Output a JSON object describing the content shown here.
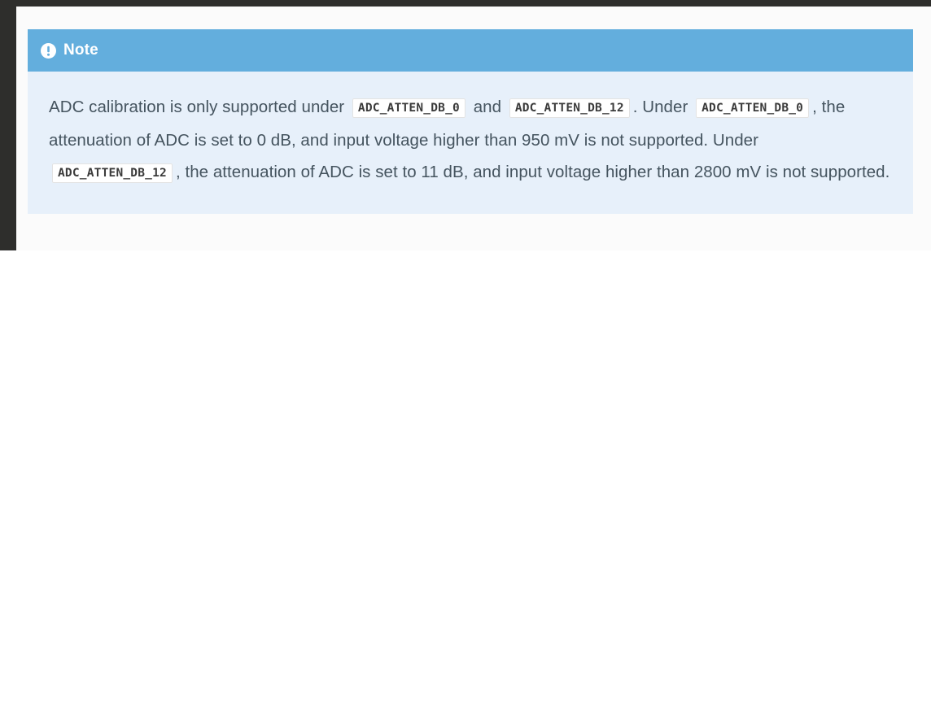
{
  "page": {
    "background_color": "#ffffff",
    "frame_color": "#2e2e2c",
    "content_background": "#fbfbfb"
  },
  "admonition": {
    "type": "note",
    "icon": "exclamation-circle-icon",
    "title": "Note",
    "header_color": "#63aedd",
    "body_color": "#e7f0fa",
    "text_color": "#45545f",
    "body": {
      "segment_1": "ADC calibration is only supported under ",
      "code_1": "ADC_ATTEN_DB_0",
      "segment_2": " and ",
      "code_2": "ADC_ATTEN_DB_12",
      "segment_3": ". Under ",
      "code_3": "ADC_ATTEN_DB_0",
      "segment_4": ", the attenuation of ADC is set to 0 dB, and input voltage higher than 950 mV is not supported. Under ",
      "code_4": "ADC_ATTEN_DB_12",
      "segment_5": ", the attenuation of ADC is set to 11 dB, and input voltage higher than 2800 mV is not supported."
    }
  }
}
